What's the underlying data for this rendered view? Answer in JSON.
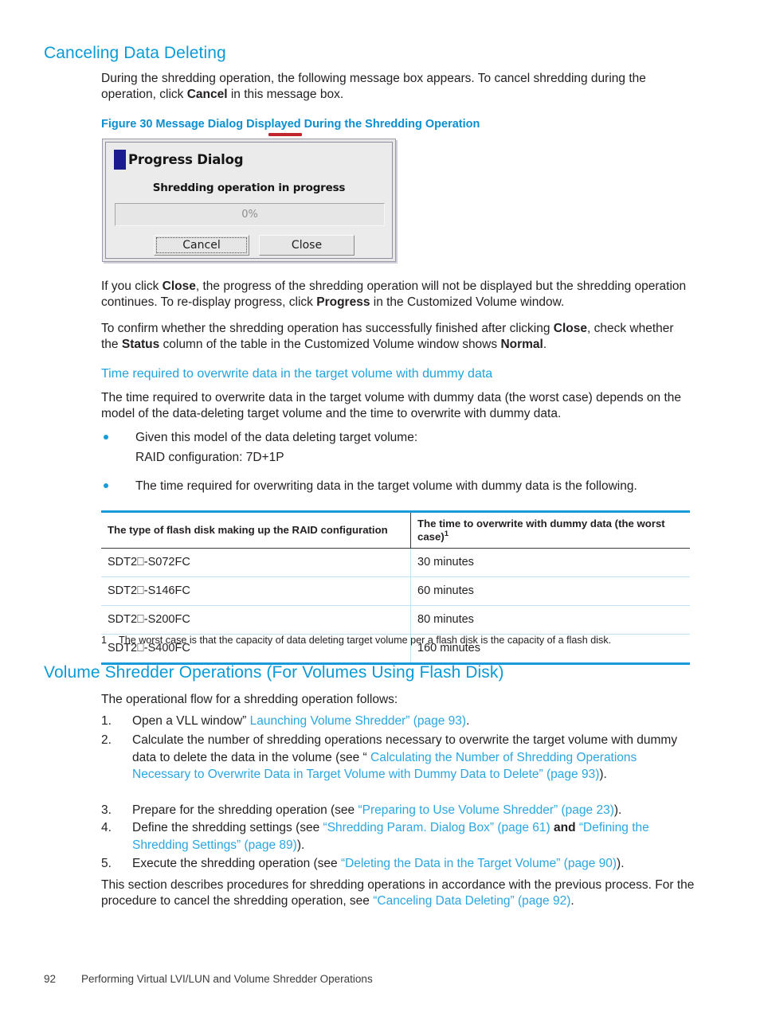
{
  "section": {
    "heading": "Canceling Data Deleting",
    "intro_before_bold": "During the shredding operation, the following message box appears. To cancel shredding during the operation, click ",
    "intro_bold": "Cancel",
    "intro_after_bold": " in this message box."
  },
  "figure": {
    "caption": "Figure 30 Message Dialog Displayed During the Shredding Operation",
    "dialog": {
      "title": "Progress Dialog",
      "message": "Shredding operation in progress",
      "progress_label": "0%",
      "progress_percent": 0,
      "cancel_label": "Cancel",
      "close_label": "Close"
    }
  },
  "after_figure": {
    "p1_a": "If you click ",
    "p1_b1": "Close",
    "p1_b": ", the progress of the shredding operation will not be displayed but the shredding operation continues. To re-display progress, click ",
    "p1_b2": "Progress",
    "p1_c": " in the Customized Volume window.",
    "p2_a": "To confirm whether the shredding operation has successfully finished after clicking ",
    "p2_b1": "Close",
    "p2_b": ", check whether the ",
    "p2_b2": "Status",
    "p2_c": " column of the table in the Customized Volume window shows ",
    "p2_b3": "Normal",
    "p2_d": "."
  },
  "time_section": {
    "heading": "Time required to overwrite data in the target volume with dummy data",
    "paragraph": "The time required to overwrite data in the target volume with dummy data (the worst case) depends on the model of the data-deleting target volume and the time to overwrite with dummy data.",
    "bullets": [
      {
        "text": "Given this model of the data deleting target volume:",
        "sub": "RAID configuration: 7D+1P"
      },
      {
        "text": "The time required for overwriting data in the target volume with dummy data is the following."
      }
    ]
  },
  "table": {
    "headers": [
      "The type of flash disk making up the RAID configuration",
      "The time to overwrite with dummy data (the worst case)"
    ],
    "header_superscript": "1",
    "rows": [
      [
        "SDT2⎕-S072FC",
        "30 minutes"
      ],
      [
        "SDT2⎕-S146FC",
        "60 minutes"
      ],
      [
        "SDT2⎕-S200FC",
        "80 minutes"
      ],
      [
        "SDT2⎕-S400FC",
        "160 minutes"
      ]
    ],
    "footnote_number": "1",
    "footnote_text": "The worst case is that the capacity of data deleting target volume per a flash disk is the capacity of a flash disk."
  },
  "operations_section": {
    "heading": "Volume Shredder Operations (For Volumes Using Flash Disk)",
    "intro": "The operational flow for a shredding operation follows:",
    "steps": [
      {
        "number": "1.",
        "a": "Open a VLL window” ",
        "link": "Launching Volume Shredder” (page 93)",
        "b": "."
      },
      {
        "number": "2.",
        "a": "Calculate the number of shredding operations necessary to overwrite the target volume with dummy data to delete the data in the volume (see “ ",
        "link": "Calculating the Number of Shredding Operations Necessary to Overwrite Data in Target Volume with Dummy Data to Delete” (page 93)",
        "b": ")."
      },
      {
        "number": "3.",
        "a": "Prepare for the shredding operation (see ",
        "link": "“Preparing to Use Volume Shredder” (page 23)",
        "b": ")."
      },
      {
        "number": "4.",
        "a": "Define the shredding settings (see ",
        "link": "“Shredding Param. Dialog Box” (page 61)",
        "mid_bold": " and ",
        "link2": "“Defining the Shredding Settings” (page 89)",
        "b": ")."
      },
      {
        "number": "5.",
        "a": "Execute the shredding operation (see ",
        "link": "“Deleting the Data in the Target Volume” (page 90)",
        "b": ")."
      }
    ],
    "closing_a": "This section describes procedures for shredding operations in accordance with the previous process. For the procedure to cancel the shredding operation, see ",
    "closing_link": "“Canceling Data Deleting” (page 92)",
    "closing_b": "."
  },
  "footer": {
    "page_number": "92",
    "running_title": "Performing Virtual LVI/LUN and Volume Shredder Operations"
  },
  "colors": {
    "heading_blue": "#0a9bd7",
    "link_blue": "#2ba6e0",
    "table_rule_blue": "#1a9ad9",
    "text_black": "#231f20",
    "dialog_icon_blue": "#1b1b8f",
    "red_mark": "#c0272d"
  }
}
